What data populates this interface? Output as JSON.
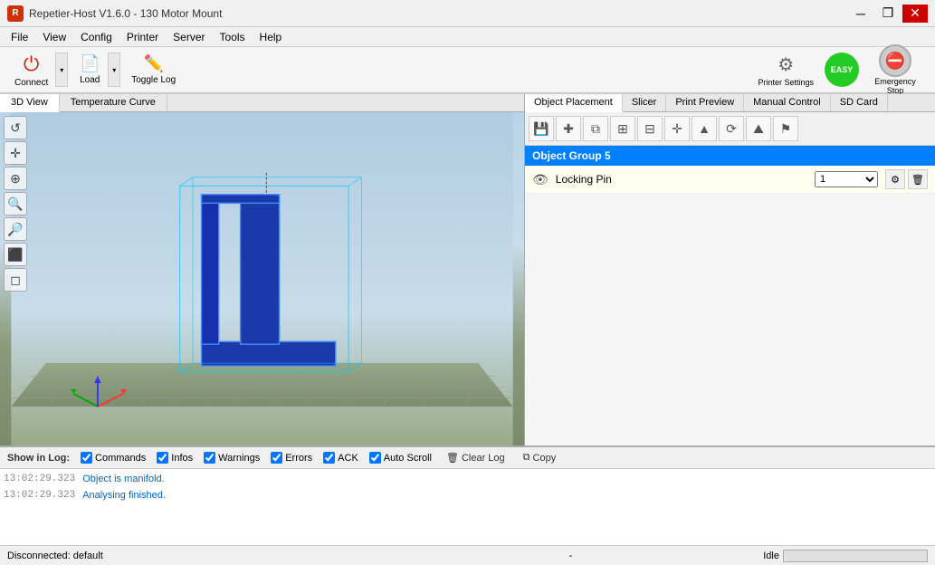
{
  "window": {
    "title": "Repetier-Host V1.6.0 - 130 Motor Mount",
    "icon": "R"
  },
  "titlebar_controls": {
    "minimize": "─",
    "restore": "❐",
    "close": "✕"
  },
  "menubar": {
    "items": [
      "File",
      "View",
      "Config",
      "Printer",
      "Server",
      "Tools",
      "Help"
    ]
  },
  "toolbar": {
    "connect_label": "Connect",
    "load_label": "Load",
    "togglelog_label": "Toggle Log",
    "printer_settings_label": "Printer Settings",
    "easy_mode_label": "EASY",
    "emergency_stop_label": "Emergency Stop"
  },
  "view_tabs": [
    "3D View",
    "Temperature Curve"
  ],
  "right_tabs": [
    "Object Placement",
    "Slicer",
    "Print Preview",
    "Manual Control",
    "SD Card"
  ],
  "object_group": {
    "name": "Object Group 5",
    "items": [
      {
        "name": "Locking Pin",
        "qty": "1",
        "visible": true
      }
    ]
  },
  "log": {
    "show_label": "Show in Log:",
    "filters": [
      "Commands",
      "Infos",
      "Warnings",
      "Errors",
      "ACK",
      "Auto Scroll"
    ],
    "clear_label": "Clear Log",
    "copy_label": "Copy",
    "entries": [
      {
        "time": "13:02:29.323",
        "msg": "Object is manifold."
      },
      {
        "time": "13:02:29.323",
        "msg": "Analysing finished."
      }
    ]
  },
  "statusbar": {
    "left": "Disconnected: default",
    "center": "-",
    "right_label": "Idle"
  }
}
